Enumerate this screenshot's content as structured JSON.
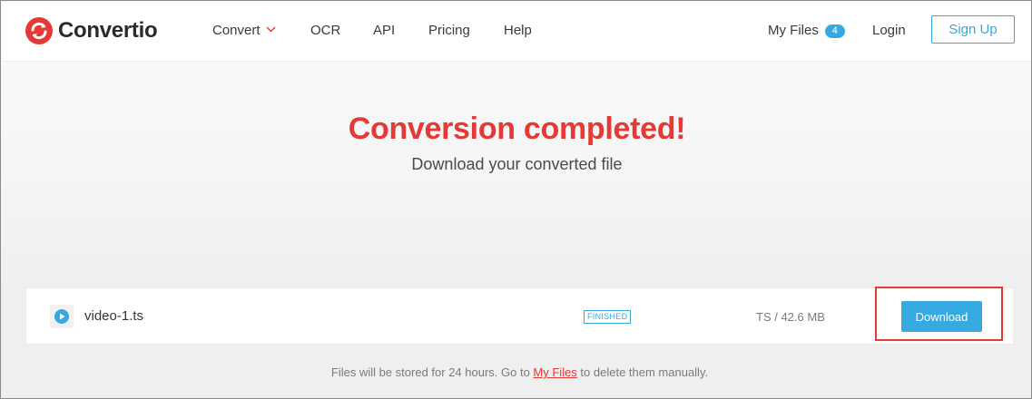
{
  "brand": {
    "name": "Convertio",
    "color": "#e53935"
  },
  "nav": {
    "convert": "Convert",
    "ocr": "OCR",
    "api": "API",
    "pricing": "Pricing",
    "help": "Help",
    "my_files": "My Files",
    "my_files_count": "4",
    "login": "Login",
    "signup": "Sign Up"
  },
  "hero": {
    "title": "Conversion completed!",
    "subtitle": "Download your converted file"
  },
  "file": {
    "name": "video-1.ts",
    "status": "FINISHED",
    "meta": "TS / 42.6 MB",
    "download_label": "Download"
  },
  "note": {
    "before": "Files will be stored for 24 hours. Go to ",
    "link": "My Files",
    "after": " to delete them manually."
  },
  "colors": {
    "accent": "#36a9e1",
    "brand_red": "#e53935"
  },
  "icons": [
    "convertio-logo-icon",
    "chevron-down-icon",
    "play-icon"
  ]
}
